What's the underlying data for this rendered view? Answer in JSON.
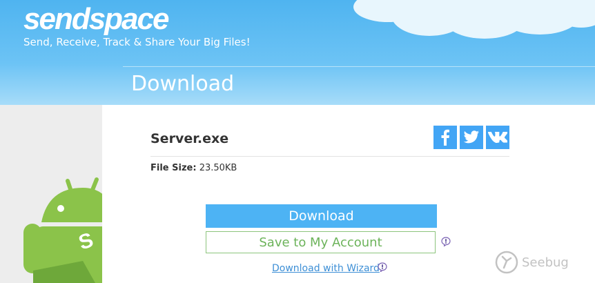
{
  "brand": {
    "logo_part1": "send",
    "logo_part2": "space"
  },
  "header": {
    "tagline": "Send, Receive, Track & Share Your Big Files!",
    "page_title": "Download"
  },
  "file": {
    "name": "Server.exe",
    "size_label": "File Size:",
    "size_value": "23.50KB"
  },
  "social": [
    {
      "glyph": "f",
      "icon": "facebook-icon"
    },
    {
      "glyph": "twitter",
      "icon": "twitter-icon"
    },
    {
      "glyph": "vk",
      "icon": "vk-icon"
    }
  ],
  "actions": {
    "download_label": "Download",
    "save_label": "Save to My Account",
    "wizard_label": "Download with Wizard"
  },
  "watermark": {
    "text": "Seebug"
  },
  "colors": {
    "header_blue": "#4fb4f0",
    "download_button": "#4db3f4",
    "save_text": "#6cb35a",
    "link": "#3d8fd6",
    "social_tile": "#42a5f5",
    "android_green": "#8bc34a"
  }
}
